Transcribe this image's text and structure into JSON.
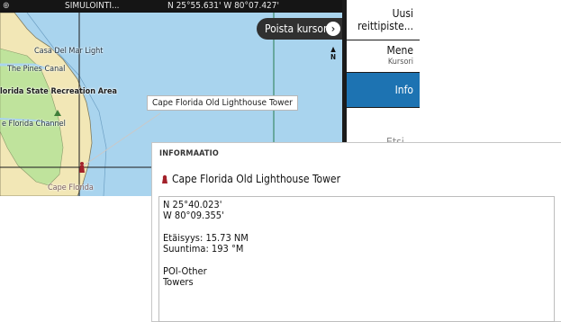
{
  "statusbar": {
    "gps_icon": "gps-icon",
    "simulation": "SIMULOINTI...",
    "coordinates": "N 25°55.631' W 80°07.427'"
  },
  "map": {
    "labels": {
      "casa_del_mar": "Casa Del Mar Light",
      "pines_canal": "The Pines Canal",
      "state_recreation": "lorida State Recreation Area",
      "florida_channel": "e Florida Channel",
      "cape_florida": "Cape Florida"
    },
    "cursor_popup": "Cape Florida Old Lighthouse Tower",
    "clear_cursor_button": "Poista kursori",
    "north_indicator": "N"
  },
  "menu": {
    "new_route": "Uusi reittipiste...",
    "goto": "Mene",
    "goto_sub": "Kursori",
    "info": "Info",
    "search": "Etsi..."
  },
  "panel": {
    "title": "INFORMAATIO",
    "poi_name": "Cape Florida Old Lighthouse Tower",
    "lat": "N  25°40.023'",
    "lon": "W  80°09.355'",
    "distance": "Etäisyys: 15.73 NM",
    "bearing": "Suuntima: 193 °M",
    "category": "POI-Other",
    "subcategory": "Towers"
  },
  "colors": {
    "water": "#a9d4ee",
    "land": "#f2e7b6",
    "green": "#bfe39c",
    "selected": "#1d73b2",
    "marker": "#a3212a"
  }
}
